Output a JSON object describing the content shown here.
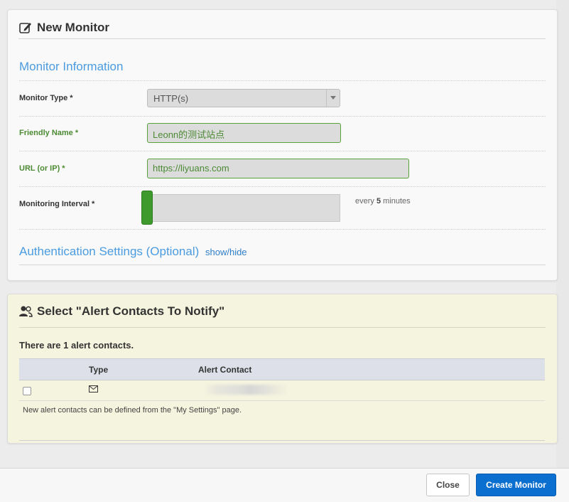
{
  "monitor_panel": {
    "title": "New Monitor",
    "title_icon": "edit-icon",
    "section_info": "Monitor Information",
    "fields": {
      "monitor_type": {
        "label": "Monitor Type *",
        "value": "HTTP(s)"
      },
      "friendly_name": {
        "label": "Friendly Name *",
        "value": "Leonn的测试站点"
      },
      "url": {
        "label": "URL (or IP) *",
        "value": "https://liyuans.com"
      },
      "interval": {
        "label": "Monitoring Interval *",
        "prefix": "every",
        "value": "5",
        "suffix": "minutes",
        "slider_level": 0.0
      }
    },
    "auth_section": {
      "heading": "Authentication Settings (Optional)",
      "toggle": "show/hide"
    }
  },
  "alerts_panel": {
    "title": "Select \"Alert Contacts To Notify\"",
    "title_icon": "users-icon",
    "count_text": "There are 1 alert contacts.",
    "columns": [
      "",
      "Type",
      "Alert Contact"
    ],
    "rows": [
      {
        "checked": false,
        "type_icon": "envelope-icon",
        "contact": ""
      }
    ],
    "note": "New alert contacts can be defined from the \"My Settings\" page."
  },
  "footer": {
    "close_label": "Close",
    "create_label": "Create Monitor"
  },
  "colors": {
    "accent_blue": "#4a9be0",
    "valid_green": "#4c8a34",
    "primary_button": "#0b6fcf",
    "alert_panel_bg": "#f5f4df"
  }
}
